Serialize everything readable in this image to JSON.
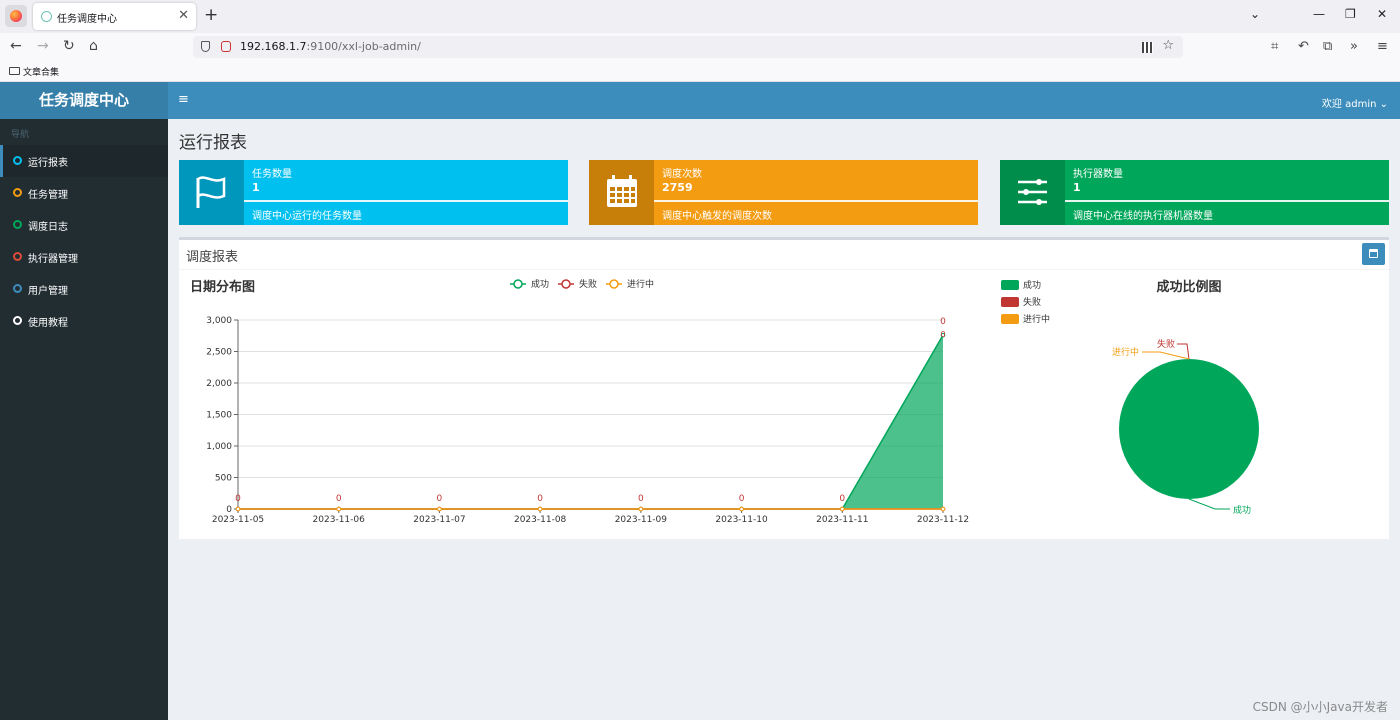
{
  "browser": {
    "tab_title": "任务调度中心",
    "url_host": "192.168.1.7",
    "url_rest": ":9100/xxl-job-admin/",
    "bookmark_label": "文章合集"
  },
  "app": {
    "logo": "任务调度中心",
    "welcome": "欢迎 admin ⌄"
  },
  "sidebar": {
    "nav_title": "导航",
    "items": [
      {
        "label": "运行报表",
        "dot_color": "#00c0ef",
        "active": true
      },
      {
        "label": "任务管理",
        "dot_color": "#f39c12",
        "active": false
      },
      {
        "label": "调度日志",
        "dot_color": "#00a65a",
        "active": false
      },
      {
        "label": "执行器管理",
        "dot_color": "#dd4b39",
        "active": false
      },
      {
        "label": "用户管理",
        "dot_color": "#3c8dbc",
        "active": false
      },
      {
        "label": "使用教程",
        "dot_color": "#ffffff",
        "active": false
      }
    ]
  },
  "page": {
    "title": "运行报表"
  },
  "info_boxes": [
    {
      "label": "任务数量",
      "value": "1",
      "desc": "调度中心运行的任务数量",
      "color": "#00c0ef",
      "icon_bg": "#0097bc",
      "icon": "flag-icon"
    },
    {
      "label": "调度次数",
      "value": "2759",
      "desc": "调度中心触发的调度次数",
      "color": "#f39c12",
      "icon_bg": "#c87f0a",
      "icon": "calendar-icon"
    },
    {
      "label": "执行器数量",
      "value": "1",
      "desc": "调度中心在线的执行器机器数量",
      "color": "#00a65a",
      "icon_bg": "#008d4c",
      "icon": "sliders-icon"
    }
  ],
  "report": {
    "title": "调度报表"
  },
  "chart_data": [
    {
      "type": "area",
      "title": "日期分布图",
      "categories": [
        "2023-11-05",
        "2023-11-06",
        "2023-11-07",
        "2023-11-08",
        "2023-11-09",
        "2023-11-10",
        "2023-11-11",
        "2023-11-12"
      ],
      "ylim": [
        0,
        3000
      ],
      "yticks": [
        "0",
        "500",
        "1,000",
        "1,500",
        "2,000",
        "2,500",
        "3,000"
      ],
      "legend": "top",
      "grid": true,
      "series": [
        {
          "name": "成功",
          "color": "#00a65a",
          "values": [
            0,
            0,
            0,
            0,
            0,
            0,
            0,
            2759
          ]
        },
        {
          "name": "失败",
          "color": "#c23632",
          "values": [
            0,
            0,
            0,
            0,
            0,
            0,
            0,
            0
          ]
        },
        {
          "name": "进行中",
          "color": "#f39c12",
          "values": [
            0,
            0,
            0,
            0,
            0,
            0,
            0,
            0
          ]
        }
      ]
    },
    {
      "type": "pie",
      "title": "成功比例图",
      "legend": "top-left",
      "slices": [
        {
          "name": "成功",
          "value": 2759,
          "color": "#00a65a"
        },
        {
          "name": "失败",
          "value": 0,
          "color": "#c23632"
        },
        {
          "name": "进行中",
          "value": 0,
          "color": "#f39c12"
        }
      ]
    }
  ],
  "watermark": "CSDN @小小Java开发者"
}
